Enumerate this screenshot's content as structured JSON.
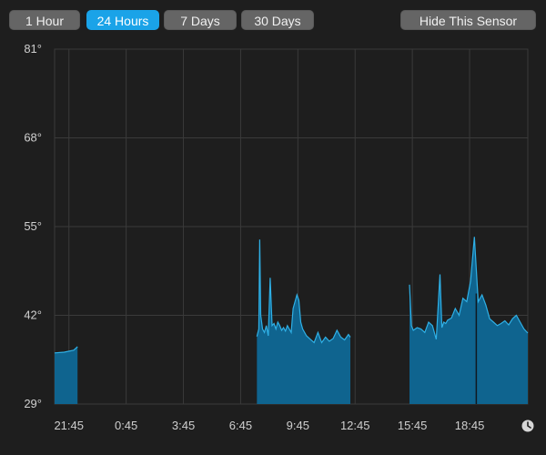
{
  "toolbar": {
    "ranges": [
      {
        "label": "1 Hour",
        "active": false
      },
      {
        "label": "24 Hours",
        "active": true
      },
      {
        "label": "7 Days",
        "active": false
      },
      {
        "label": "30 Days",
        "active": false
      }
    ],
    "hide_label": "Hide This Sensor"
  },
  "colors": {
    "accent": "#1aa3e8",
    "fill": "#0f648f",
    "line": "#2fb0e6",
    "grid": "#3a3a3a",
    "background": "#1e1e1e"
  },
  "chart_data": {
    "type": "area",
    "y_ticks": [
      "81°",
      "68°",
      "55°",
      "42°",
      "29°"
    ],
    "y_tick_values": [
      81,
      68,
      55,
      42,
      29
    ],
    "ylim": [
      29,
      81
    ],
    "x_ticks": [
      "21:45",
      "0:45",
      "3:45",
      "6:45",
      "9:45",
      "12:45",
      "15:45",
      "18:45"
    ],
    "x_tick_hours": [
      21.75,
      24.75,
      27.75,
      30.75,
      33.75,
      36.75,
      39.75,
      42.75
    ],
    "xlim": [
      21.0,
      45.8
    ],
    "grid": true,
    "clock_icon": "clock-icon",
    "segments": [
      {
        "x": [
          21.0,
          21.5,
          22.0,
          22.2
        ],
        "y": [
          36.5,
          36.6,
          36.9,
          37.4
        ]
      },
      {
        "x": [
          31.6,
          31.7,
          31.75,
          31.8,
          31.9,
          32.0,
          32.1,
          32.2,
          32.3,
          32.4,
          32.5,
          32.6,
          32.7,
          32.8,
          32.9,
          33.0,
          33.1,
          33.2,
          33.3,
          33.4,
          33.5,
          33.6,
          33.7,
          33.8,
          33.9,
          34.0,
          34.2,
          34.4,
          34.6,
          34.8,
          35.0,
          35.2,
          35.4,
          35.6,
          35.8,
          36.0,
          36.2,
          36.4,
          36.5
        ],
        "y": [
          38.9,
          40.0,
          53.1,
          42.0,
          40.0,
          39.5,
          40.5,
          39.0,
          47.5,
          40.5,
          40.8,
          40.0,
          41.0,
          40.5,
          39.8,
          40.2,
          39.7,
          40.5,
          40.0,
          39.5,
          43.0,
          44.0,
          45.0,
          44.2,
          41.0,
          40.0,
          39.0,
          38.5,
          38.0,
          39.5,
          38.0,
          38.8,
          38.2,
          38.6,
          39.8,
          38.8,
          38.4,
          39.2,
          38.8
        ]
      },
      {
        "x": [
          39.6,
          39.7,
          39.8,
          39.9,
          40.0,
          40.2,
          40.4,
          40.6,
          40.8,
          41.0,
          41.2,
          41.3,
          41.4,
          41.5,
          41.6,
          41.8,
          42.0,
          42.2,
          42.4,
          42.6,
          42.8,
          43.0,
          43.2,
          43.4,
          43.6,
          43.8,
          44.0,
          44.2,
          44.4,
          44.6,
          44.8,
          45.0,
          45.2,
          45.4,
          45.6,
          45.8
        ],
        "y": [
          46.5,
          40.5,
          39.8,
          40.0,
          40.2,
          40.0,
          39.5,
          41.0,
          40.5,
          38.5,
          48.0,
          40.2,
          41.0,
          40.8,
          41.3,
          41.6,
          43.0,
          42.0,
          44.5,
          44.0,
          47.0,
          53.5,
          44.0,
          45.0,
          43.5,
          41.5,
          41.0,
          40.5,
          40.8,
          41.2,
          40.6,
          41.5,
          42.0,
          41.0,
          40.0,
          39.4
        ]
      }
    ],
    "cursor_hour": 43.1
  }
}
